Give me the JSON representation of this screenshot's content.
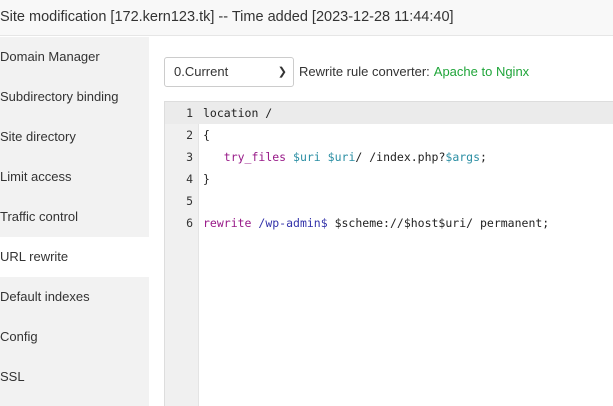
{
  "header": {
    "title": "Site modification [172.kern123.tk] -- Time added [2023-12-28 11:44:40]"
  },
  "sidebar": {
    "items": [
      {
        "label": "Domain Manager"
      },
      {
        "label": "Subdirectory binding"
      },
      {
        "label": "Site directory"
      },
      {
        "label": "Limit access"
      },
      {
        "label": "Traffic control"
      },
      {
        "label": "URL rewrite",
        "active": true
      },
      {
        "label": "Default indexes"
      },
      {
        "label": "Config"
      },
      {
        "label": "SSL"
      }
    ]
  },
  "main": {
    "select_value": "0.Current",
    "converter_label": "Rewrite rule converter:",
    "converter_link": "Apache to Nginx",
    "lines": [
      {
        "n": "1",
        "parts": [
          [
            "",
            "location /"
          ]
        ]
      },
      {
        "n": "2",
        "parts": [
          [
            "",
            "{"
          ]
        ]
      },
      {
        "n": "3",
        "parts": [
          [
            "",
            "   "
          ],
          [
            "kw",
            "try_files"
          ],
          [
            "",
            " "
          ],
          [
            "var",
            "$uri"
          ],
          [
            "",
            " "
          ],
          [
            "var",
            "$uri"
          ],
          [
            "",
            "/ /index.php?"
          ],
          [
            "var",
            "$args"
          ],
          [
            "",
            ";"
          ]
        ]
      },
      {
        "n": "4",
        "parts": [
          [
            "",
            "}"
          ]
        ]
      },
      {
        "n": "5",
        "parts": []
      },
      {
        "n": "6",
        "parts": [
          [
            "kw",
            "rewrite"
          ],
          [
            "",
            " "
          ],
          [
            "path",
            "/wp-admin$"
          ],
          [
            "",
            " $scheme://$host$uri/ permanent;"
          ]
        ]
      }
    ]
  }
}
